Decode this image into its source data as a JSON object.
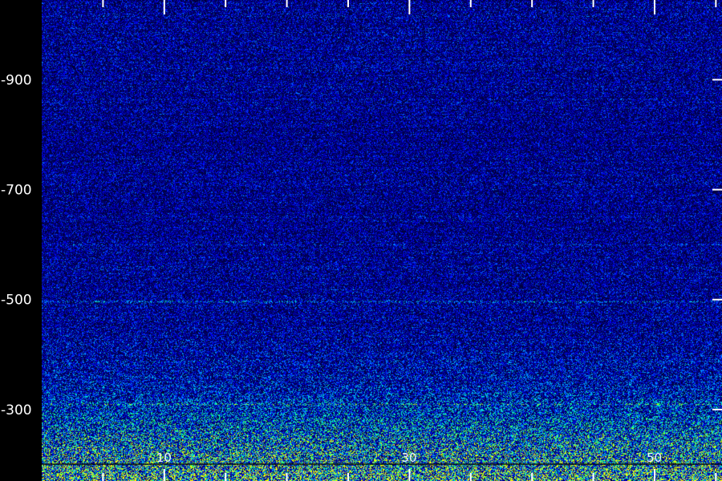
{
  "chart_data": {
    "type": "heatmap",
    "title": "",
    "xlabel": "",
    "ylabel": "",
    "x_range": [
      0,
      55.5
    ],
    "y_range": [
      170,
      1045
    ],
    "y_ticks": [
      {
        "value": 900,
        "label": "-900"
      },
      {
        "value": 700,
        "label": "-700"
      },
      {
        "value": 500,
        "label": "-500"
      },
      {
        "value": 300,
        "label": "-300"
      }
    ],
    "x_major_ticks": [
      10,
      30,
      50
    ],
    "x_tick_labels": [
      {
        "value": 10,
        "label": "10"
      },
      {
        "value": 30,
        "label": "30"
      },
      {
        "value": 50,
        "label": "50"
      }
    ],
    "x_minor_ticks": [
      5,
      15,
      20,
      25,
      35,
      40,
      45,
      55
    ],
    "grid": false,
    "colormap": [
      "#000022",
      "#000080",
      "#0000ff",
      "#00a0ff",
      "#00ffc0",
      "#40ff40",
      "#ffff00"
    ],
    "intensity_profile": [
      {
        "y": 170,
        "intensity": 0.85
      },
      {
        "y": 200,
        "intensity": 0.72
      },
      {
        "y": 250,
        "intensity": 0.55
      },
      {
        "y": 300,
        "intensity": 0.42
      },
      {
        "y": 350,
        "intensity": 0.32
      },
      {
        "y": 450,
        "intensity": 0.26
      },
      {
        "y": 600,
        "intensity": 0.24
      },
      {
        "y": 800,
        "intensity": 0.24
      },
      {
        "y": 1045,
        "intensity": 0.25
      }
    ],
    "horizontal_bands": [
      {
        "y": 497,
        "strength": 0.18
      },
      {
        "y": 600,
        "strength": 0.08
      },
      {
        "y": 310,
        "strength": 0.2
      }
    ]
  },
  "colors": {
    "background": "#000000",
    "axis": "#ffffff"
  }
}
